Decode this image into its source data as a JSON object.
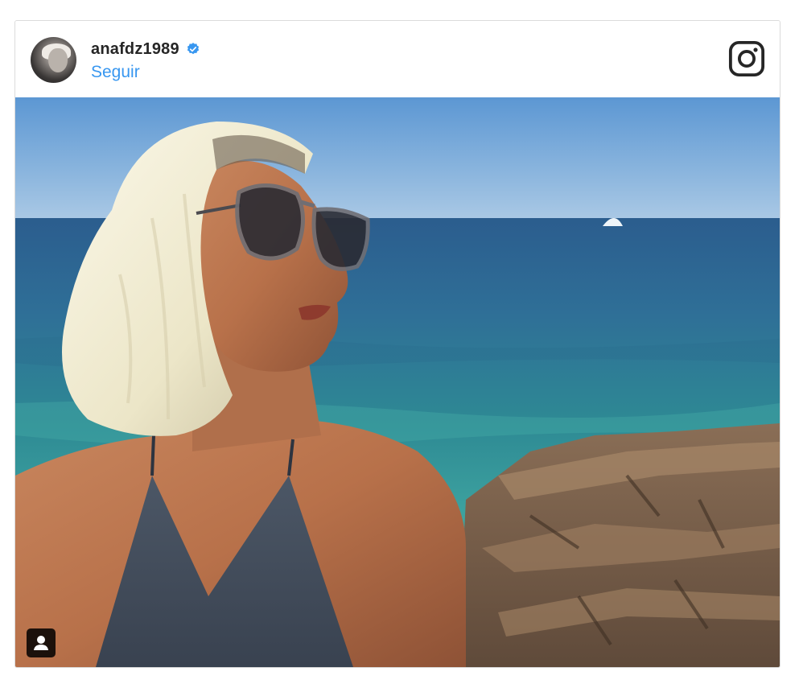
{
  "post": {
    "username": "anafdz1989",
    "follow_label": "Seguir",
    "verified": true
  },
  "icons": {
    "verified": "verified-badge-icon",
    "logo": "instagram-logo-icon",
    "tag": "user-tag-icon"
  },
  "colors": {
    "link": "#3897f0",
    "verified": "#3897f0",
    "text": "#262626",
    "border": "#dbdbdb"
  }
}
